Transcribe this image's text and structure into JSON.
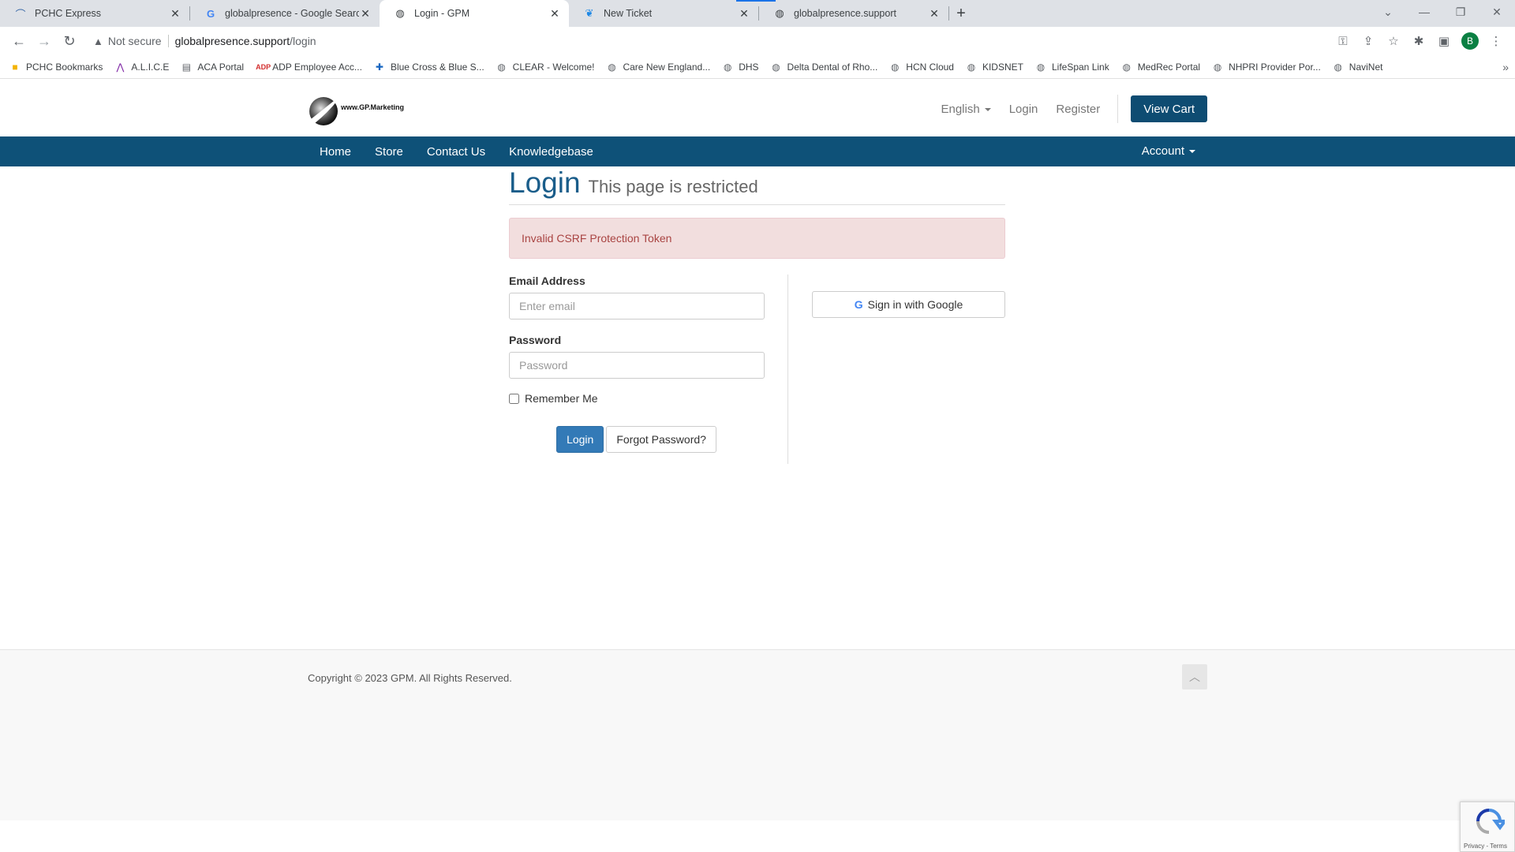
{
  "browser": {
    "tabs": [
      {
        "title": "PCHC Express",
        "icon": "pchc-icon"
      },
      {
        "title": "globalpresence - Google Search",
        "icon": "google-icon"
      },
      {
        "title": "Login - GPM",
        "icon": "globe-icon",
        "active": true
      },
      {
        "title": "New Ticket",
        "icon": "feather-icon"
      },
      {
        "title": "globalpresence.support",
        "icon": "globe-icon"
      }
    ],
    "address": {
      "security": "Not secure",
      "host": "globalpresence.support",
      "path": "/login"
    },
    "profile_initial": "B",
    "bookmarks": [
      "PCHC Bookmarks",
      "A.L.I.C.E",
      "ACA Portal",
      "ADP Employee Acc...",
      "Blue Cross & Blue S...",
      "CLEAR - Welcome!",
      "Care New England...",
      "DHS",
      "Delta Dental of Rho...",
      "HCN Cloud",
      "KIDSNET",
      "LifeSpan Link",
      "MedRec Portal",
      "NHPRI Provider Por...",
      "NaviNet"
    ]
  },
  "site": {
    "logo_text": "www.GP.Marketing",
    "header": {
      "language": "English",
      "login": "Login",
      "register": "Register",
      "view_cart": "View Cart"
    },
    "nav": {
      "items": [
        "Home",
        "Store",
        "Contact Us",
        "Knowledgebase"
      ],
      "account": "Account"
    }
  },
  "login_page": {
    "title": "Login",
    "subtitle": "This page is restricted",
    "alert": "Invalid CSRF Protection Token",
    "email_label": "Email Address",
    "email_placeholder": "Enter email",
    "password_label": "Password",
    "password_placeholder": "Password",
    "remember_label": "Remember Me",
    "login_button": "Login",
    "forgot_button": "Forgot Password?",
    "google_button": "Sign in with Google"
  },
  "footer": {
    "copyright": "Copyright © 2023 GPM. All Rights Reserved.",
    "recaptcha_links": "Privacy - Terms"
  },
  "colors": {
    "brand": "#0e5178",
    "link_primary": "#337ab7",
    "alert_bg": "#f2dede",
    "alert_text": "#a94442"
  }
}
